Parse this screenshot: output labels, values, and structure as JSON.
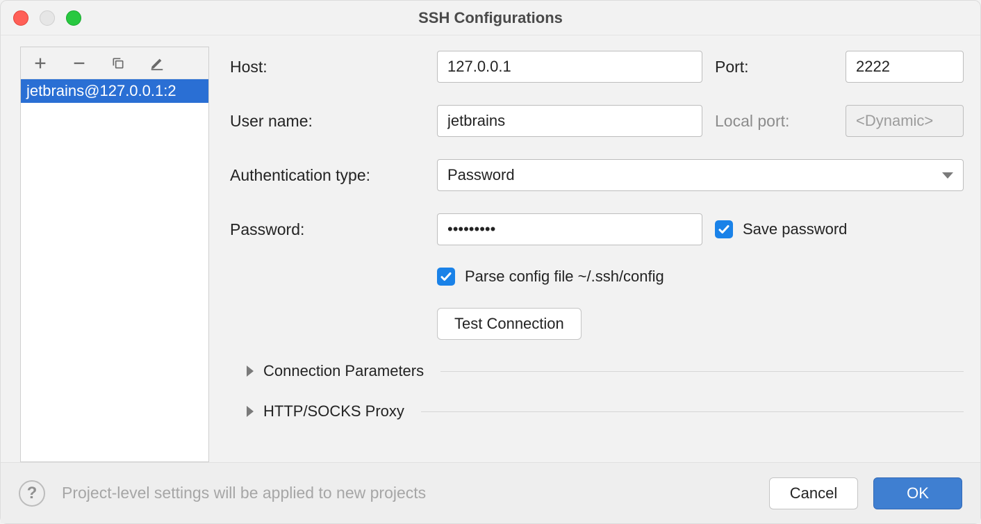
{
  "window": {
    "title": "SSH Configurations"
  },
  "sidebar": {
    "items": [
      "jetbrains@127.0.0.1:2"
    ]
  },
  "form": {
    "labels": {
      "host": "Host:",
      "port": "Port:",
      "username": "User name:",
      "local_port": "Local port:",
      "auth_type": "Authentication type:",
      "password": "Password:"
    },
    "values": {
      "host": "127.0.0.1",
      "port": "2222",
      "username": "jetbrains",
      "local_port_placeholder": "<Dynamic>",
      "auth_type": "Password",
      "password": "•••••••••"
    },
    "checkboxes": {
      "save_password": "Save password",
      "parse_config": "Parse config file ~/.ssh/config"
    },
    "buttons": {
      "test_connection": "Test Connection"
    },
    "sections": {
      "connection_params": "Connection Parameters",
      "proxy": "HTTP/SOCKS Proxy"
    }
  },
  "footer": {
    "hint": "Project-level settings will be applied to new projects",
    "cancel": "Cancel",
    "ok": "OK"
  }
}
